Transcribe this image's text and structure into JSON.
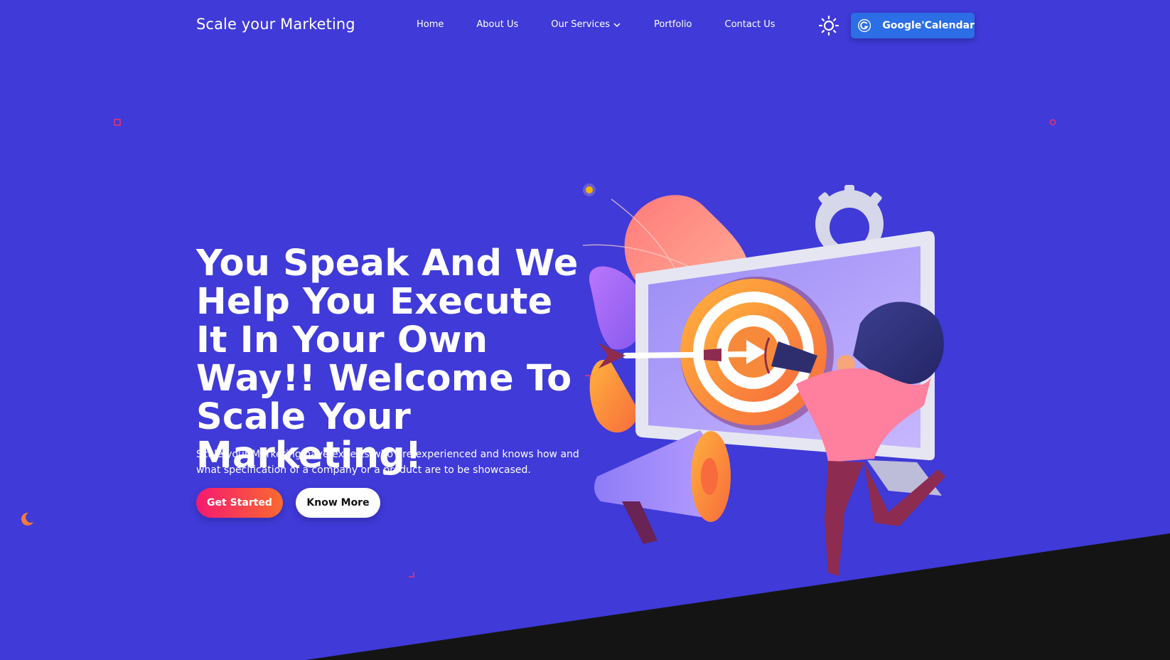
{
  "header": {
    "brand": "Scale your Marketing",
    "nav": [
      {
        "label": "Home"
      },
      {
        "label": "About Us"
      },
      {
        "label": "Our Services",
        "has_dropdown": true
      },
      {
        "label": "Portfolio"
      },
      {
        "label": "Contact Us"
      }
    ],
    "theme_toggle_icon": "sun-icon",
    "calendar_button": {
      "label": "Google'Calendar",
      "icon": "google-icon"
    }
  },
  "hero": {
    "title": "You Speak And We Help You Execute It In Your Own Way!! Welcome To Scale Your Marketing!",
    "description": "Scale your Marketing have experts who are experienced and knows how and what specification of a company or a product are to be showcased.",
    "primary_button": "Get Started",
    "secondary_button": "Know More"
  },
  "colors": {
    "background": "#3f3ad8",
    "dark_band": "#141414",
    "accent_button": "#2b6ee6",
    "cta_gradient_start": "#f5196f",
    "cta_gradient_end": "#fa6a2f"
  }
}
